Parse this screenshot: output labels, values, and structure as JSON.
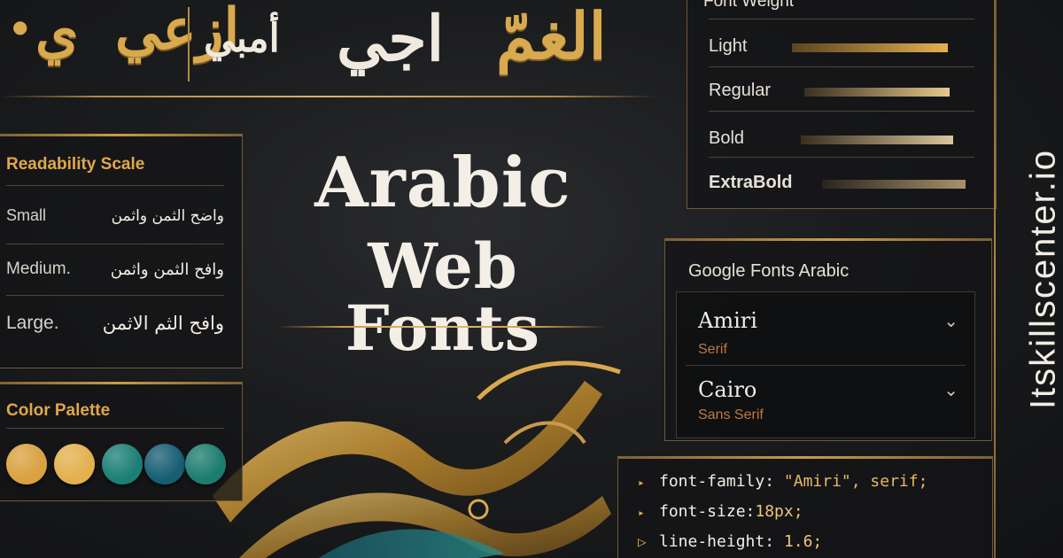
{
  "top_calligraphy": [
    "ي",
    "ازعي",
    "أمبي",
    "اجي",
    "الغمّ"
  ],
  "headline": {
    "line1": "Arabic",
    "line2": "Web Fonts"
  },
  "readability": {
    "title": "Readability Scale",
    "rows": [
      {
        "label": "Small",
        "arabic": "واضح الثمن واثمن"
      },
      {
        "label": "Medium.",
        "arabic": "وافح الثمن واثمن"
      },
      {
        "label": "Large.",
        "arabic": "وافح الثم الاثمن"
      }
    ]
  },
  "palette": {
    "title": "Color Palette",
    "colors": [
      "#d9a140",
      "#e3b04e",
      "#1c7f75",
      "#175e73",
      "#1b7d6e"
    ]
  },
  "font_weight": {
    "title": "Font Weight",
    "rows": [
      {
        "label": "Light"
      },
      {
        "label": "Regular"
      },
      {
        "label": "Bold"
      },
      {
        "label": "ExtraBold"
      }
    ]
  },
  "google_fonts": {
    "title": "Google Fonts Arabic",
    "items": [
      {
        "name": "Amiri",
        "category": "Serif",
        "icon": "chevron-down-icon"
      },
      {
        "name": "Cairo",
        "category": "Sans Serif",
        "icon": "chevron-down-icon"
      }
    ]
  },
  "code": {
    "lines": [
      {
        "prop": "font-family:",
        "value": "\"Amiri\", serif;"
      },
      {
        "prop": "font-size:",
        "value": "18px;"
      },
      {
        "prop": "line-height:",
        "value": "1.6;"
      }
    ]
  },
  "brand": {
    "text": "Itskillscenter.io"
  }
}
